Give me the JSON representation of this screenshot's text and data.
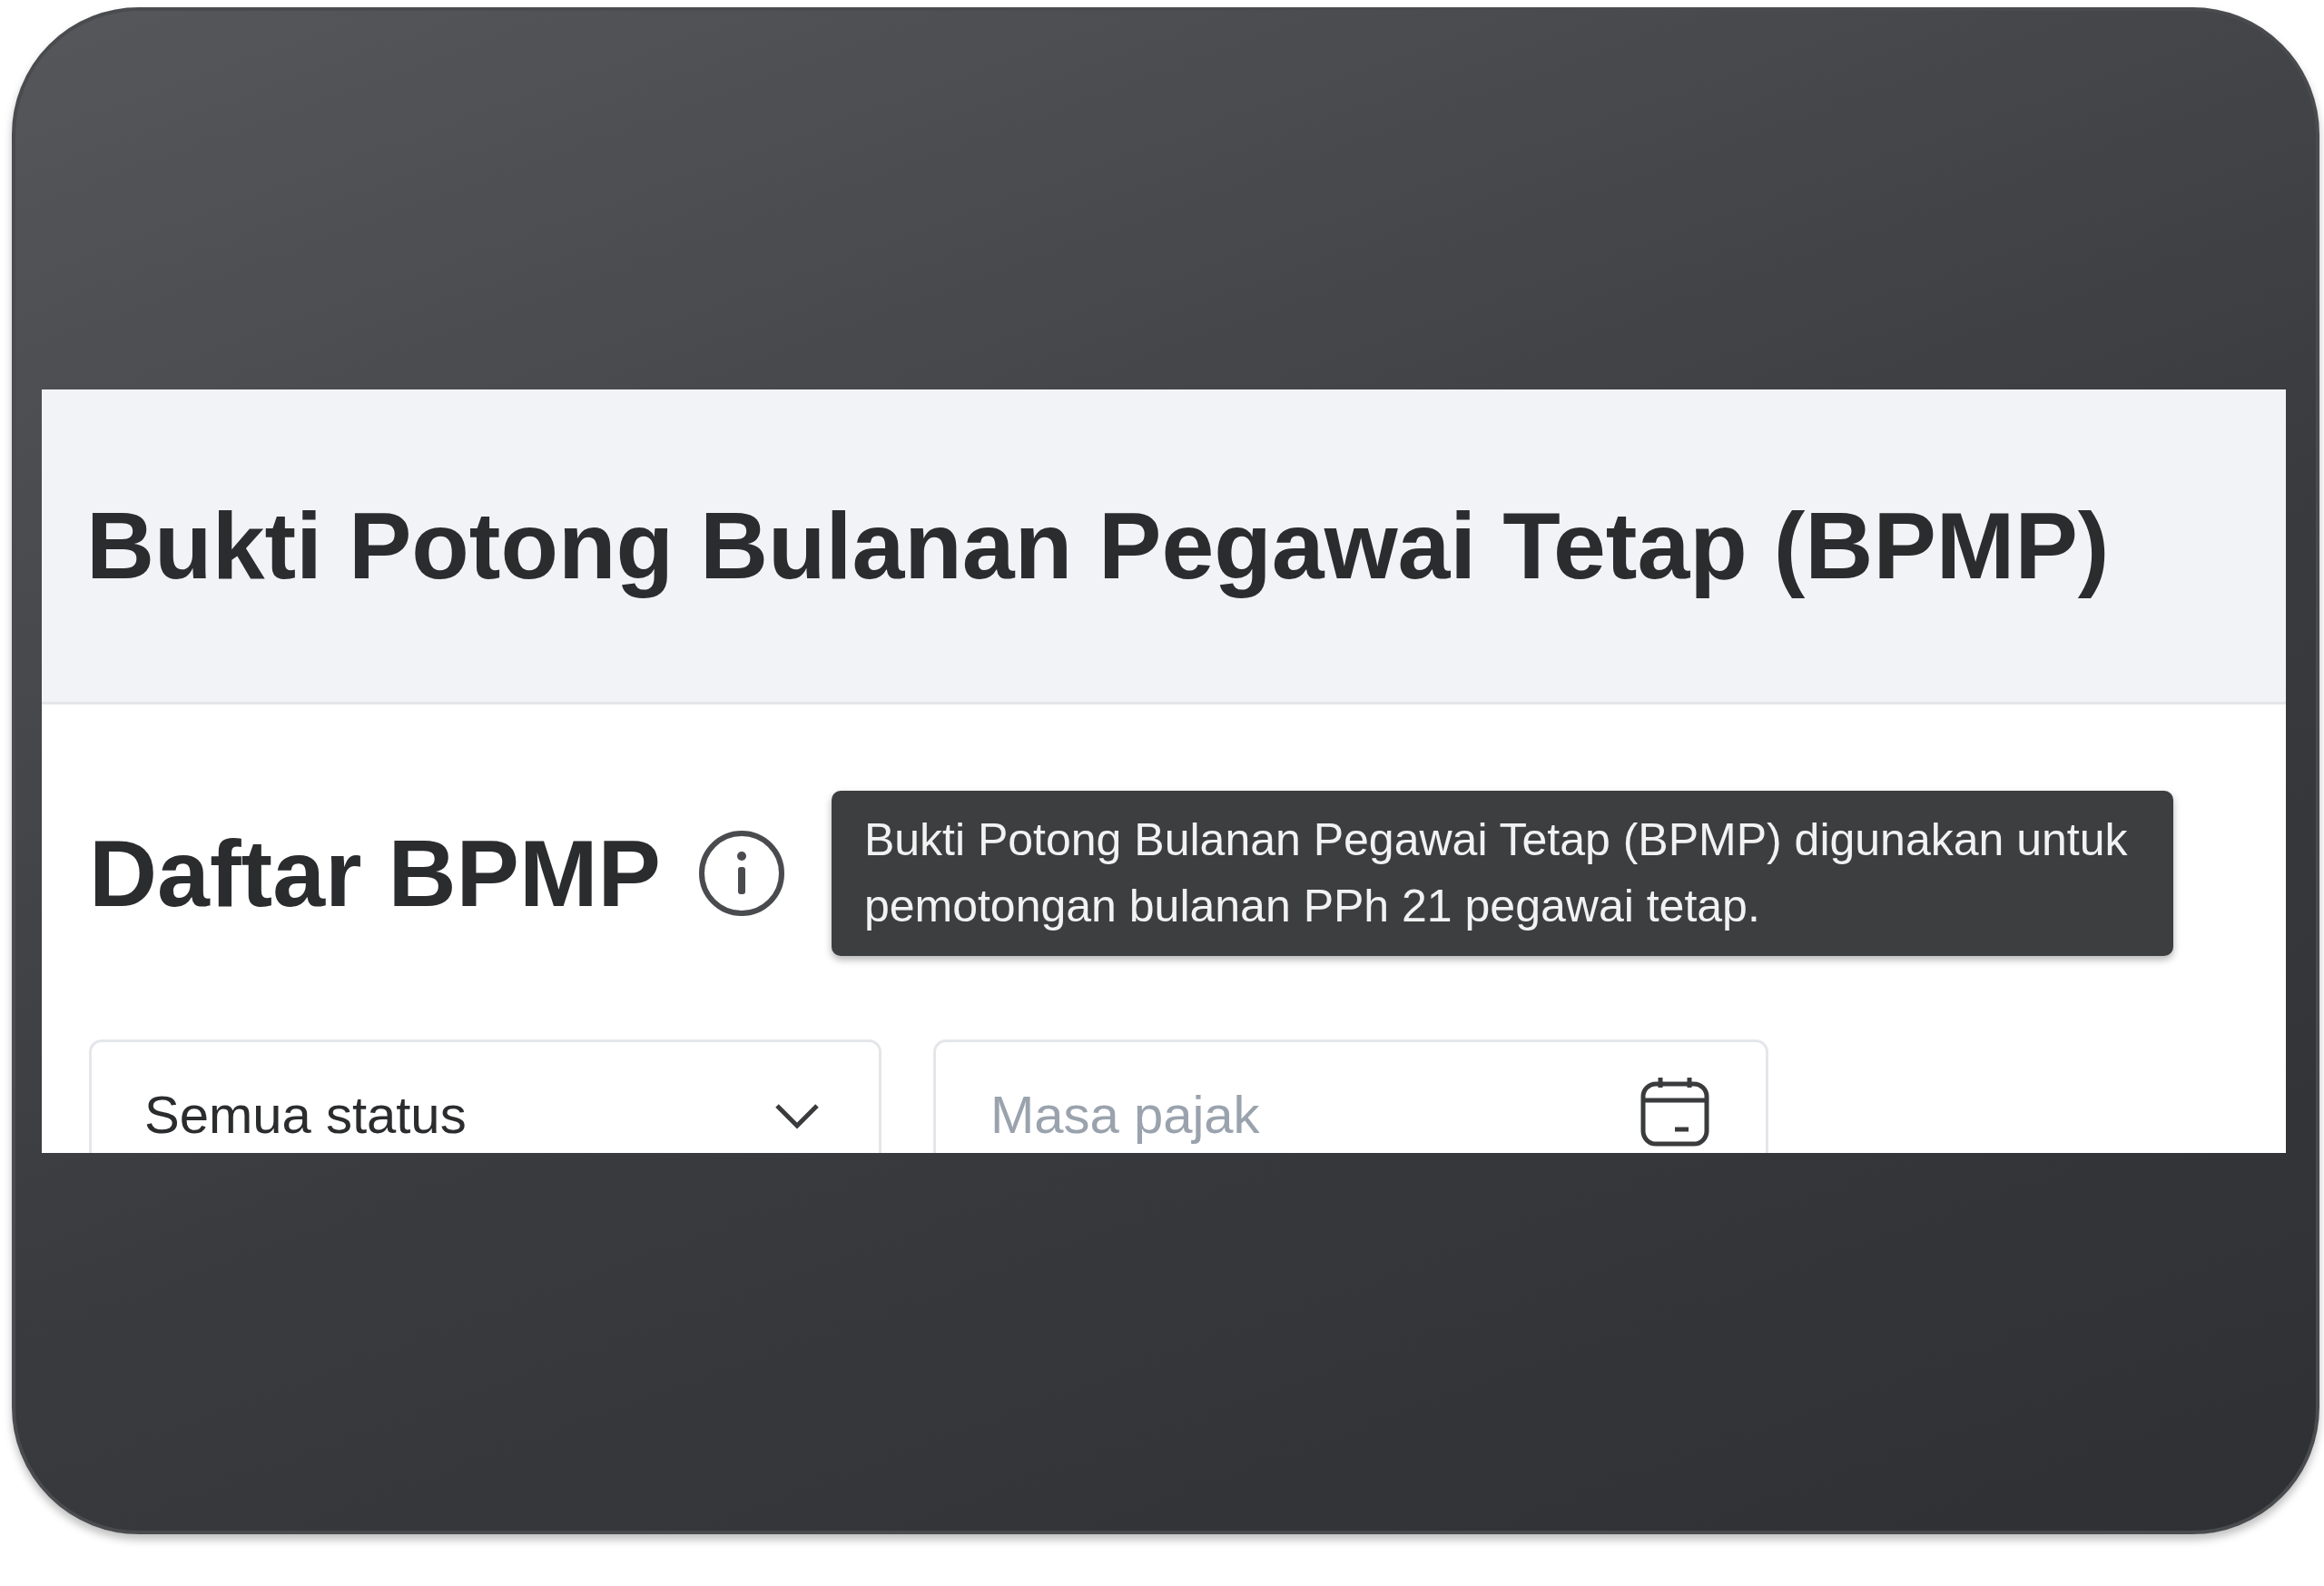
{
  "header": {
    "title": "Bukti Potong Bulanan Pegawai Tetap (BPMP)"
  },
  "section": {
    "title": "Daftar BPMP",
    "tooltip": "Bukti Potong Bulanan Pegawai Tetap (BPMP) digunakan untuk pemotongan bulanan PPh 21 pegawai tetap."
  },
  "filters": [
    {
      "kind": "dropdown",
      "value": "Semua status"
    },
    {
      "kind": "date",
      "placeholder": "Masa pajak"
    }
  ]
}
